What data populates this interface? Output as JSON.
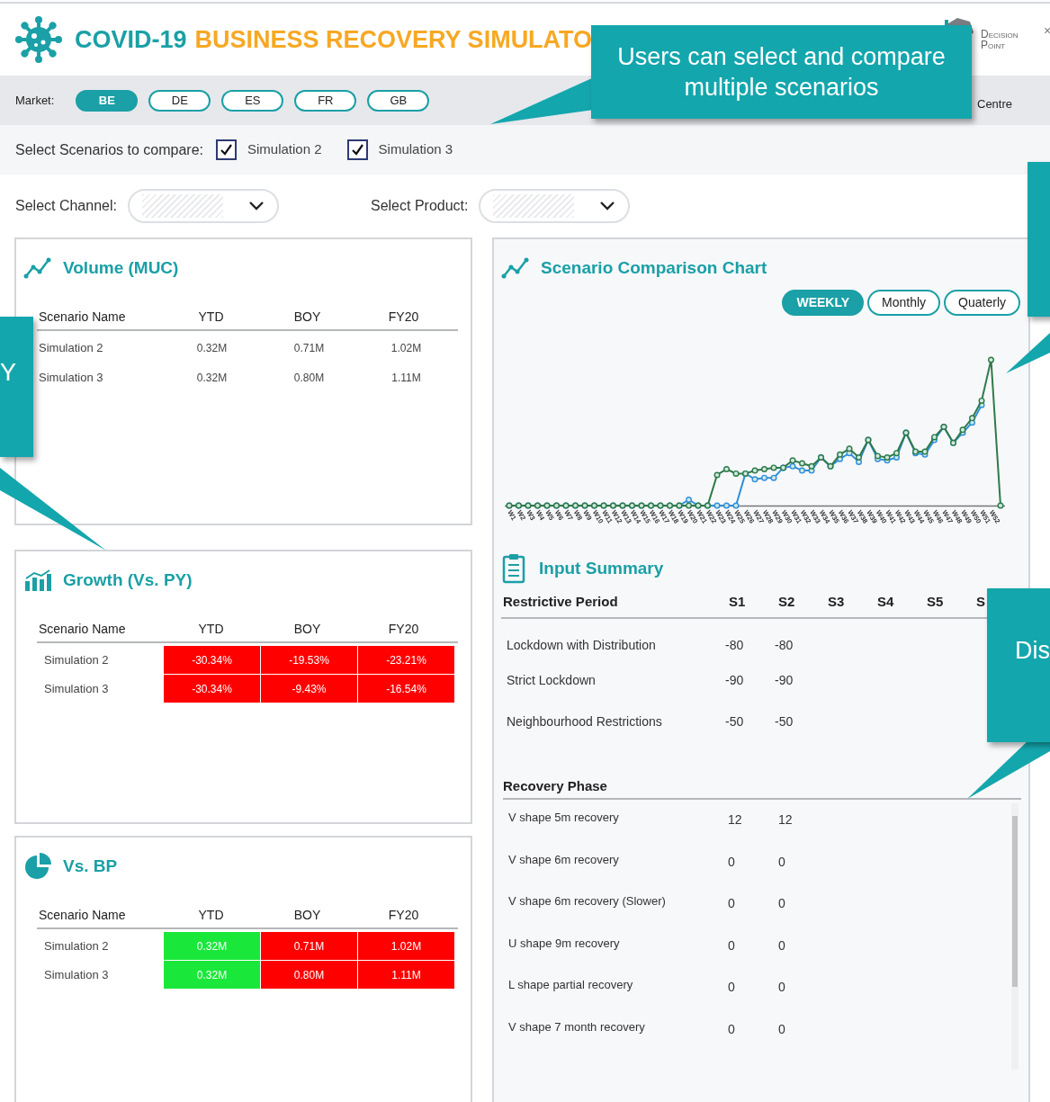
{
  "header": {
    "title_lead": "COVID-19",
    "title_rest": "BUSINESS RECOVERY SIMULATO",
    "logo_line1": "Decision",
    "logo_line2": "Point",
    "close": "×"
  },
  "market": {
    "label": "Market:",
    "options": [
      {
        "label": "BE",
        "selected": true
      },
      {
        "label": "DE",
        "selected": false
      },
      {
        "label": "ES",
        "selected": false
      },
      {
        "label": "FR",
        "selected": false
      },
      {
        "label": "GB",
        "selected": false
      }
    ],
    "trailing_text": "Centre"
  },
  "scenarios": {
    "label": "Select Scenarios to compare:",
    "items": [
      {
        "label": "Simulation 2",
        "checked": true
      },
      {
        "label": "Simulation 3",
        "checked": true
      }
    ]
  },
  "filters": [
    {
      "label": "Select Channel:"
    },
    {
      "label": "Select Product:"
    }
  ],
  "volume": {
    "title": "Volume (MUC)",
    "columns": [
      "Scenario Name",
      "YTD",
      "BOY",
      "FY20"
    ],
    "rows": [
      {
        "cells": [
          {
            "text": "Simulation 2"
          },
          {
            "text": "0.32M"
          },
          {
            "text": "0.71M"
          },
          {
            "text": "1.02M"
          }
        ]
      },
      {
        "cells": [
          {
            "text": "Simulation 3"
          },
          {
            "text": "0.32M"
          },
          {
            "text": "0.80M"
          },
          {
            "text": "1.11M"
          }
        ]
      }
    ]
  },
  "growth": {
    "title": "Growth (Vs. PY)",
    "columns": [
      "Scenario Name",
      "YTD",
      "BOY",
      "FY20"
    ],
    "rows": [
      {
        "cells": [
          {
            "text": "Simulation 2"
          },
          {
            "text": "-30.34%",
            "color": "#ff0000"
          },
          {
            "text": "-19.53%",
            "color": "#ff0000"
          },
          {
            "text": "-23.21%",
            "color": "#ff0000"
          }
        ]
      },
      {
        "cells": [
          {
            "text": "Simulation 3"
          },
          {
            "text": "-30.34%",
            "color": "#ff0000"
          },
          {
            "text": "-9.43%",
            "color": "#ff0000"
          },
          {
            "text": "-16.54%",
            "color": "#ff0000"
          }
        ]
      }
    ]
  },
  "vs_bp": {
    "title": "Vs. BP",
    "columns": [
      "Scenario Name",
      "YTD",
      "BOY",
      "FY20"
    ],
    "rows": [
      {
        "cells": [
          {
            "text": "Simulation 2"
          },
          {
            "text": "0.32M",
            "color": "#19e83a"
          },
          {
            "text": "0.71M",
            "color": "#ff0000"
          },
          {
            "text": "1.02M",
            "color": "#ff0000"
          }
        ]
      },
      {
        "cells": [
          {
            "text": "Simulation 3"
          },
          {
            "text": "0.32M",
            "color": "#19e83a"
          },
          {
            "text": "0.80M",
            "color": "#ff0000"
          },
          {
            "text": "1.11M",
            "color": "#ff0000"
          }
        ]
      }
    ]
  },
  "comparison": {
    "title": "Scenario Comparison Chart",
    "periods": [
      {
        "label": "WEEKLY",
        "selected": true
      },
      {
        "label": "Monthly",
        "selected": false
      },
      {
        "label": "Quaterly",
        "selected": false
      }
    ],
    "x_labels": [
      "W1",
      "W2",
      "W3",
      "W4",
      "W5",
      "W6",
      "W7",
      "W8",
      "W9",
      "W10",
      "W11",
      "W12",
      "W13",
      "W14",
      "W15",
      "W16",
      "W17",
      "W18",
      "W19",
      "W20",
      "W21",
      "W22",
      "W23",
      "W24",
      "W25",
      "W26",
      "W27",
      "W28",
      "W29",
      "W30",
      "W31",
      "W32",
      "W33",
      "W34",
      "W35",
      "W36",
      "W37",
      "W38",
      "W39",
      "W40",
      "W41",
      "W42",
      "W43",
      "W44",
      "W45",
      "W46",
      "W47",
      "W48",
      "W49",
      "W50",
      "W51",
      "W52"
    ]
  },
  "input_summary": {
    "title": "Input Summary",
    "restrictive": {
      "heading": "Restrictive Period",
      "columns": [
        "S1",
        "S2",
        "S3",
        "S4",
        "S5",
        "S"
      ],
      "rows": [
        {
          "name": "Lockdown with Distribution",
          "values": [
            "-80",
            "-80"
          ]
        },
        {
          "name": "Strict Lockdown",
          "values": [
            "-90",
            "-90"
          ]
        },
        {
          "name": "Neighbourhood Restrictions",
          "values": [
            "-50",
            "-50"
          ]
        }
      ]
    },
    "recovery": {
      "heading": "Recovery Phase",
      "rows": [
        {
          "name": "V shape 5m recovery",
          "values": [
            "12",
            "12"
          ]
        },
        {
          "name": "V shape 6m recovery",
          "values": [
            "0",
            "0"
          ]
        },
        {
          "name": "V shape 6m recovery (Slower)",
          "values": [
            "0",
            "0"
          ]
        },
        {
          "name": "U shape 9m recovery",
          "values": [
            "0",
            "0"
          ]
        },
        {
          "name": "L shape partial recovery",
          "values": [
            "0",
            "0"
          ]
        },
        {
          "name": "V shape 7 month recovery",
          "values": [
            "0",
            "0"
          ]
        }
      ]
    }
  },
  "callouts": [
    {
      "kind": "top",
      "text": "Users can select and compare multiple scenarios"
    },
    {
      "kind": "left",
      "text": "Y"
    },
    {
      "kind": "right_top"
    },
    {
      "kind": "right_bottom",
      "text": "Dis"
    }
  ]
}
